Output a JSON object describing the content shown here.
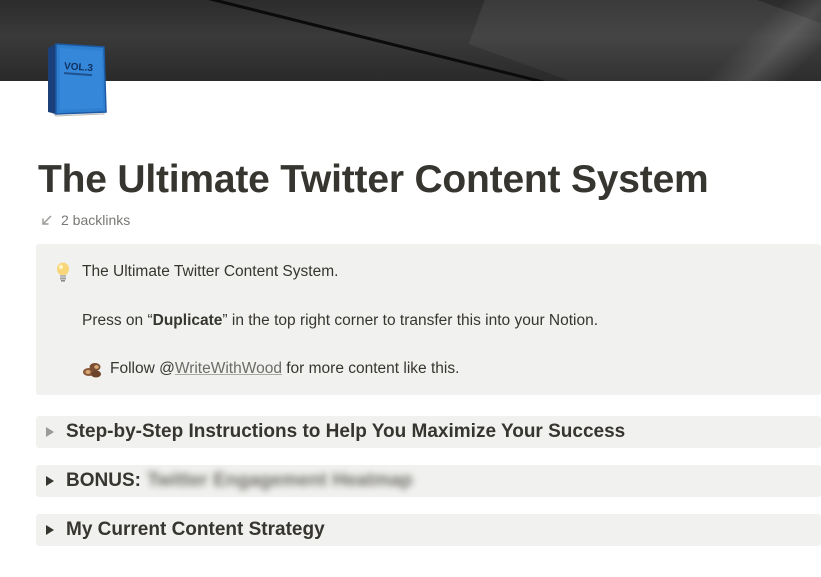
{
  "cover": {
    "description_icon": "dark-cover-image"
  },
  "page_icon": {
    "icon": "blue-book-icon",
    "text": "VOL.3"
  },
  "title": "The Ultimate Twitter Content System",
  "backlinks": {
    "icon": "backlink-arrow-icon",
    "label": "2 backlinks"
  },
  "callout": {
    "icon": "lightbulb-icon",
    "line1": "The Ultimate Twitter Content System.",
    "line2_prefix": "Press on “",
    "line2_bold": "Duplicate",
    "line2_suffix": "” in the top right corner to transfer this into your Notion.",
    "line3_icon": "wood-logs-icon",
    "line3_prefix": "Follow @",
    "line3_mention": "WriteWithWood",
    "line3_suffix": " for more content like this."
  },
  "toggles": [
    {
      "label": "Step-by-Step Instructions to Help You Maximize Your Success",
      "blurred": ""
    },
    {
      "label": "BONUS:",
      "blurred": "Twitter Engagement Heatmap"
    },
    {
      "label": "My Current Content Strategy",
      "blurred": ""
    }
  ],
  "colors": {
    "text": "#37352f",
    "muted": "#787774",
    "block_bg": "#f1f1ef",
    "book_blue": "#2f7fd1"
  }
}
